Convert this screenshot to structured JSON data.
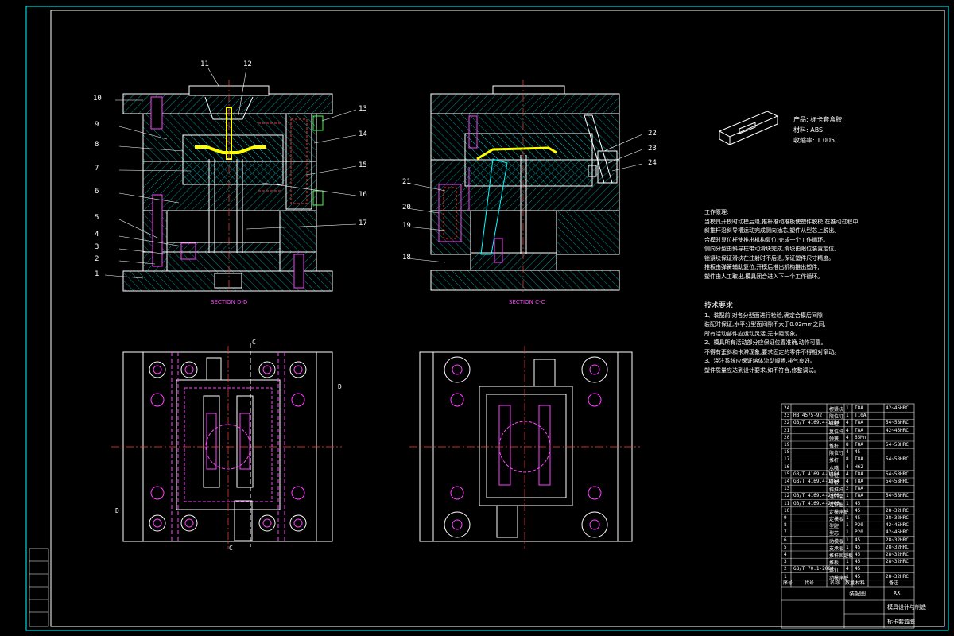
{
  "drawing": {
    "part_numbers": [
      "1",
      "2",
      "3",
      "4",
      "5",
      "6",
      "7",
      "8",
      "9",
      "10",
      "11",
      "12",
      "13",
      "14",
      "15",
      "16",
      "17",
      "18",
      "19",
      "20",
      "21",
      "22",
      "23",
      "24"
    ],
    "section_left": "SECTION D-D",
    "section_right": "SECTION C-C",
    "cut_labels": [
      "C",
      "C",
      "D",
      "D"
    ]
  },
  "product_info": {
    "product": "产品: 标卡套盒胶",
    "material": "材料: ABS",
    "shrinkage": "收缩率: 1.005"
  },
  "work_process": {
    "title": "工作原理:",
    "lines": [
      "当模具开模时动模后退,推杆推动推板使塑件脱模,在推动过程中",
      "斜推杆沿斜导槽运动完成侧向抽芯,塑件从型芯上脱出。",
      "合模时复位杆使推出机构复位,完成一个工作循环。",
      "侧向分型由斜导柱带动滑块完成,滑块由限位装置定位,",
      "锁紧块保证滑块在注射时不后退,保证塑件尺寸精度。",
      "推板由弹簧辅助复位,开模后推出机构推出塑件,",
      "塑件由人工取出,模具闭合进入下一个工作循环。"
    ]
  },
  "tech_req": {
    "title": "技术要求",
    "lines": [
      "1、装配前,对各分型面进行检验,确定合模后间隙",
      "装配时保证,水平分型面间隙不大于0.02mm之间,",
      "所有活动部件应运动灵活,无卡阻现象。",
      "2、模具所有活动部分应保证位置准确,动作可靠。",
      "不得有歪斜和卡滞现象,要求固定的零件不得相对窜动。",
      "3、浇注系统应保证熔体流动顺畅,排气良好。",
      "塑件质量应达到设计要求,如不符合,修整调试。"
    ]
  },
  "bom": {
    "rows": [
      [
        "24",
        "",
        "楔紧块",
        "1",
        "T8A",
        "42~45HRC"
      ],
      [
        "23",
        "HB 4575-92",
        "限位钉",
        "1",
        "T10A",
        ""
      ],
      [
        "22",
        "GB/T 4169.4-1984",
        "导柱",
        "4",
        "T8A",
        "54~58HRC"
      ],
      [
        "21",
        "",
        "复位杆",
        "4",
        "T8A",
        "42~45HRC"
      ],
      [
        "20",
        "",
        "弹簧",
        "4",
        "65Mn",
        ""
      ],
      [
        "19",
        "",
        "推杆",
        "8",
        "T8A",
        "54~58HRC"
      ],
      [
        "18",
        "",
        "限位钉",
        "4",
        "45",
        ""
      ],
      [
        "17",
        "",
        "推杆",
        "8",
        "T8A",
        "54~58HRC"
      ],
      [
        "16",
        "",
        "水嘴",
        "4",
        "H62",
        ""
      ],
      [
        "15",
        "GB/T 4169.4-1984",
        "导柱",
        "4",
        "T8A",
        "54~58HRC"
      ],
      [
        "14",
        "GB/T 4169.4-1984",
        "导套",
        "4",
        "T8A",
        "54~58HRC"
      ],
      [
        "13",
        "",
        "斜推杆",
        "2",
        "T8A",
        ""
      ],
      [
        "12",
        "GB/T 4169.4-2006",
        "浇口套",
        "1",
        "T8A",
        "54~58HRC"
      ],
      [
        "11",
        "GB/T 4169.4-2006",
        "定位圈",
        "1",
        "45",
        ""
      ],
      [
        "10",
        "",
        "定模座板",
        "1",
        "45",
        "28~32HRC"
      ],
      [
        "9",
        "",
        "定模板",
        "1",
        "45",
        "28~32HRC"
      ],
      [
        "8",
        "",
        "型腔",
        "1",
        "P20",
        "42~45HRC"
      ],
      [
        "7",
        "",
        "型芯",
        "1",
        "P20",
        "42~45HRC"
      ],
      [
        "6",
        "",
        "动模板",
        "1",
        "45",
        "28~32HRC"
      ],
      [
        "5",
        "",
        "支承板",
        "1",
        "45",
        "28~32HRC"
      ],
      [
        "4",
        "",
        "推杆固定板",
        "1",
        "45",
        "28~32HRC"
      ],
      [
        "3",
        "",
        "推板",
        "1",
        "45",
        "28~32HRC"
      ],
      [
        "2",
        "GB/T 70.1-2000",
        "螺钉",
        "4",
        "45",
        ""
      ],
      [
        "1",
        "",
        "动模座板",
        "1",
        "45",
        "28~32HRC"
      ]
    ],
    "header": [
      "序号",
      "代号",
      "名称",
      "数量",
      "材料",
      "备注"
    ],
    "title_block": {
      "project": "XX",
      "drawing_name": "装配图",
      "part_name": "标卡套盒胶",
      "school": "模具设计与制造"
    }
  },
  "side_block": [
    "",
    "",
    "",
    "",
    "",
    ""
  ],
  "colors": {
    "outline": "#ffffff",
    "hatch": "#00d0d0",
    "dash": "#ff3030",
    "center": "#ff4040",
    "magenta": "#ff40ff",
    "yellow": "#ffff00",
    "green": "#40ff40",
    "cyan": "#00ffff"
  }
}
